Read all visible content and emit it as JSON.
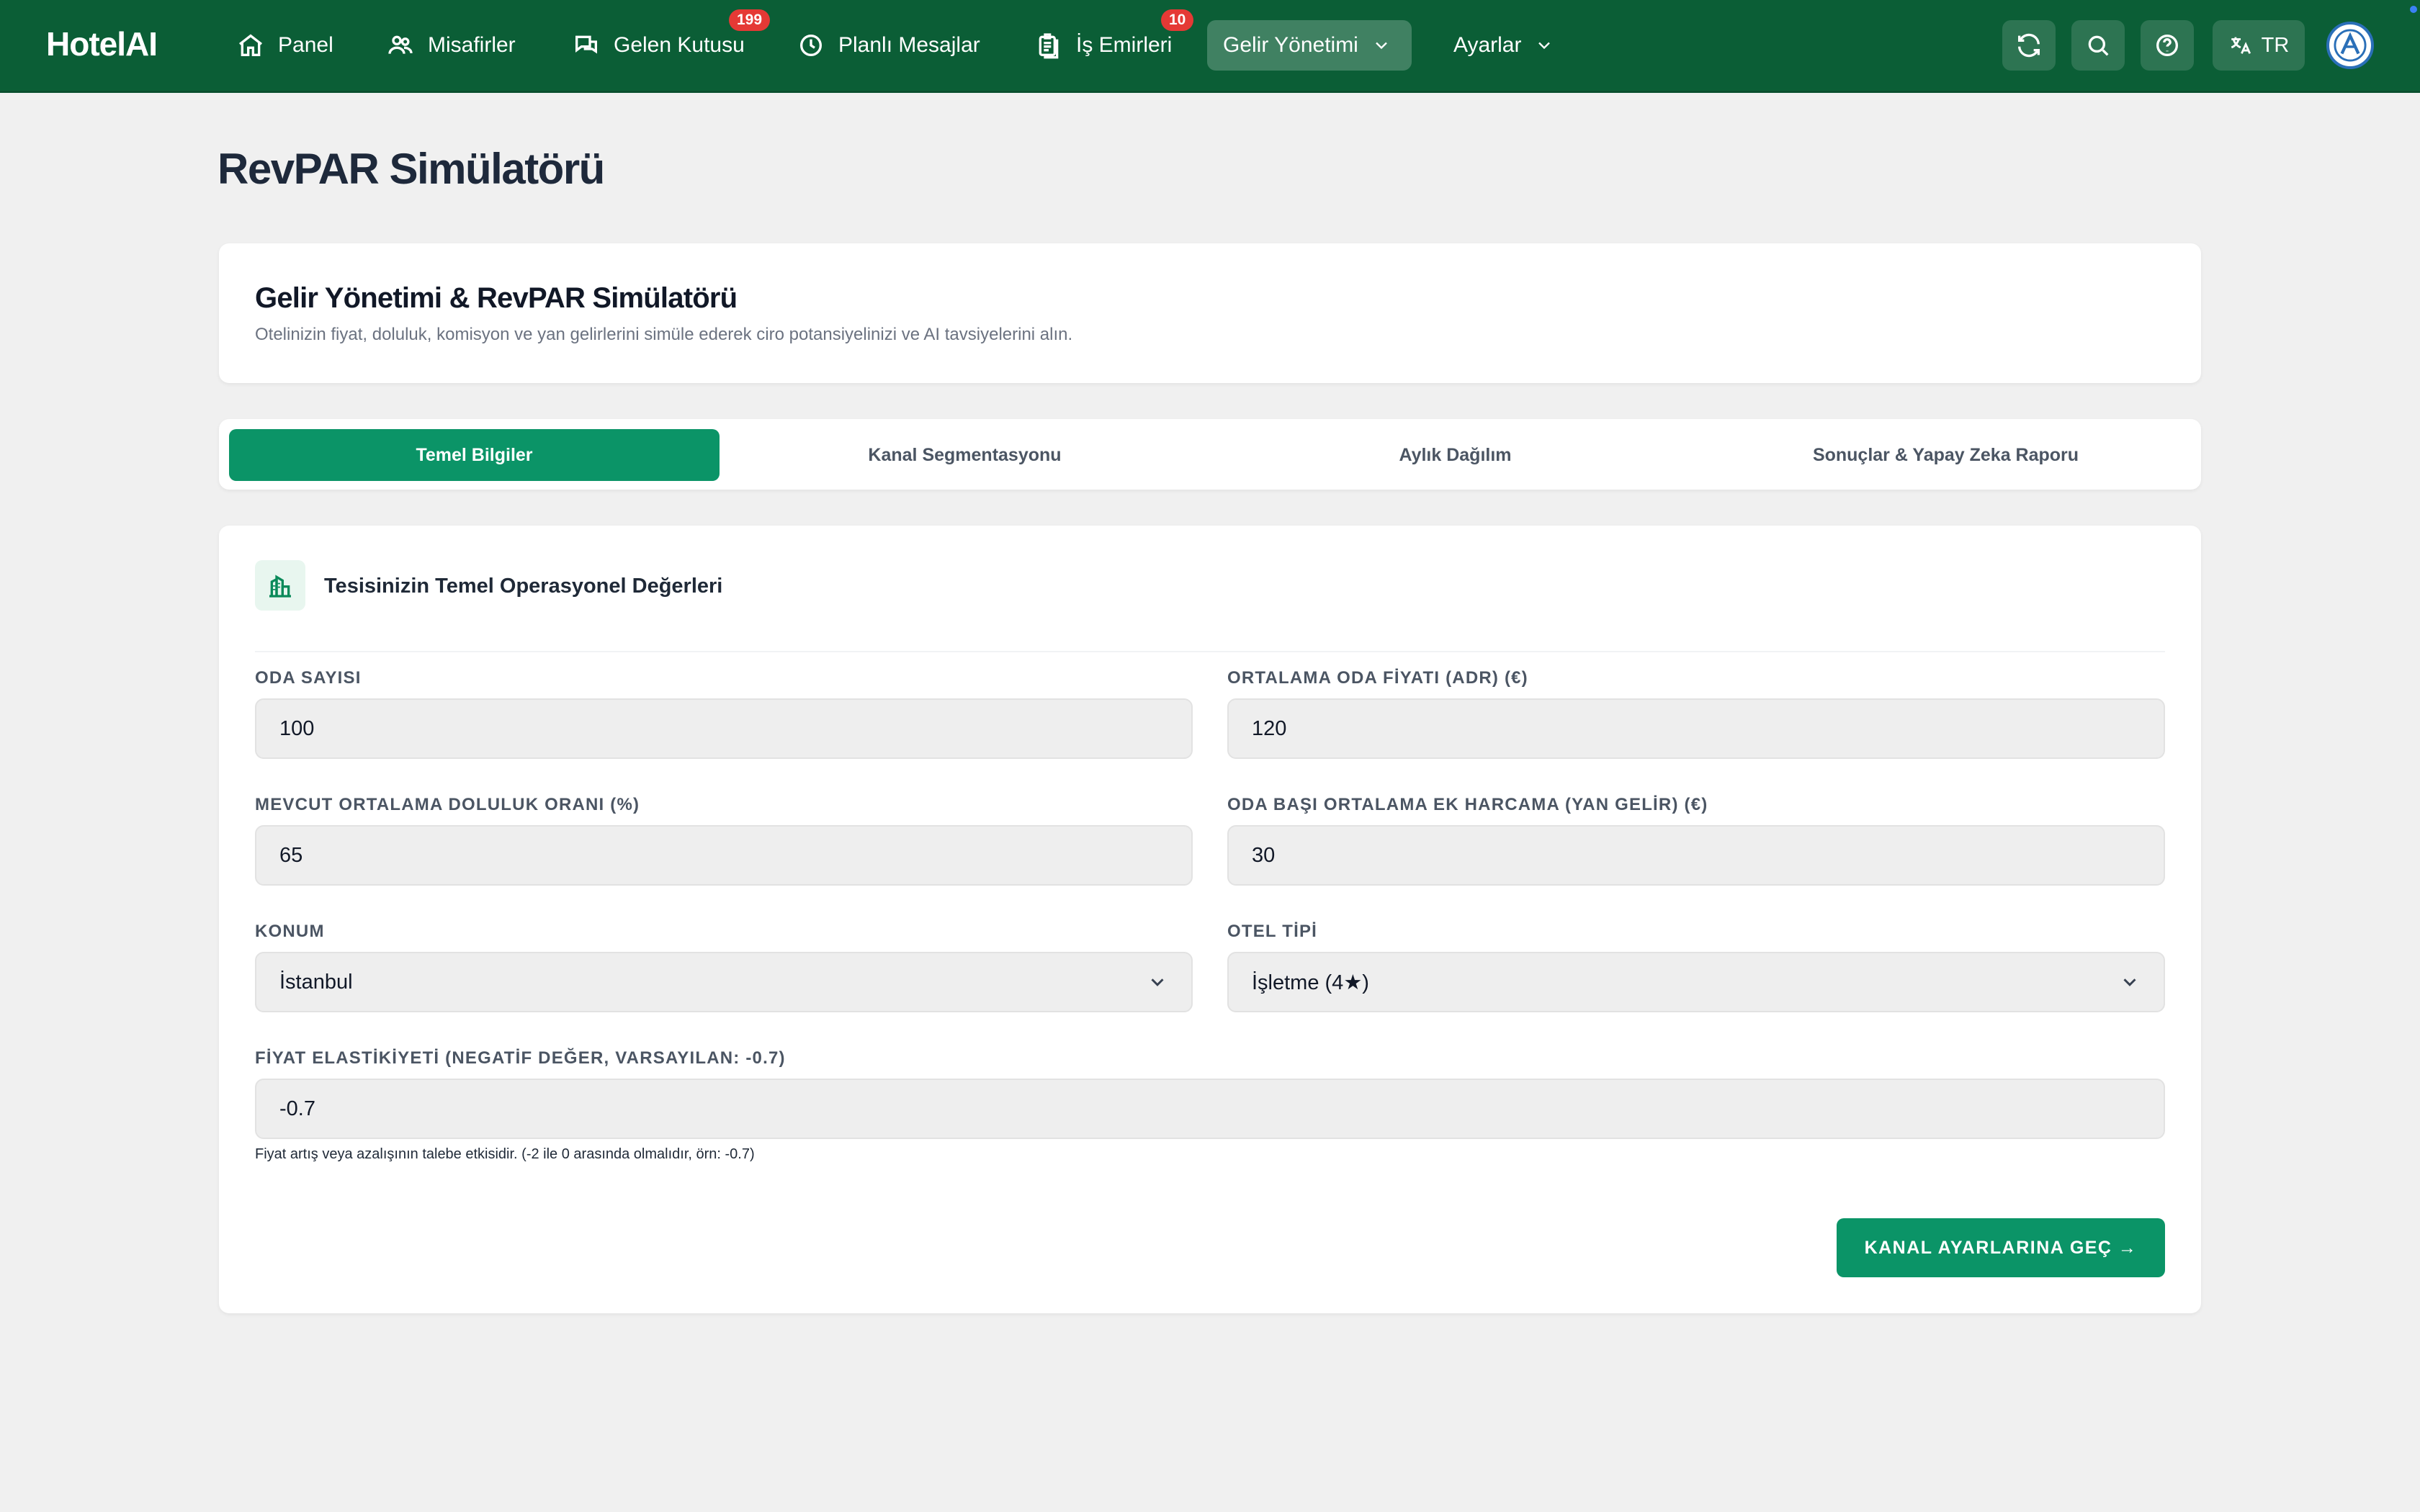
{
  "brand": "HotelAI",
  "nav": {
    "panel": "Panel",
    "guests": "Misafirler",
    "inbox": "Gelen Kutusu",
    "inbox_badge": "199",
    "scheduled": "Planlı Mesajlar",
    "work_orders": "İş Emirleri",
    "work_orders_badge": "10",
    "revenue": "Gelir Yönetimi",
    "settings": "Ayarlar",
    "lang": "TR"
  },
  "page_title": "RevPAR Simülatörü",
  "intro": {
    "title": "Gelir Yönetimi & RevPAR Simülatörü",
    "subtitle": "Otelinizin fiyat, doluluk, komisyon ve yan gelirlerini simüle ederek ciro potansiyelinizi ve AI tavsiyelerini alın."
  },
  "tabs": [
    "Temel Bilgiler",
    "Kanal Segmentasyonu",
    "Aylık Dağılım",
    "Sonuçlar & Yapay Zeka Raporu"
  ],
  "section_title": "Tesisinizin Temel Operasyonel Değerleri",
  "fields": {
    "rooms": {
      "label": "ODA SAYISI",
      "value": "100"
    },
    "adr": {
      "label": "ORTALAMA ODA FİYATI (ADR) (€)",
      "value": "120"
    },
    "occupancy": {
      "label": "MEVCUT ORTALAMA DOLULUK ORANI (%)",
      "value": "65"
    },
    "ancillary": {
      "label": "ODA BAŞI ORTALAMA EK HARCAMA (YAN GELİR) (€)",
      "value": "30"
    },
    "location": {
      "label": "KONUM",
      "value": "İstanbul"
    },
    "hotel_type": {
      "label": "OTEL TİPİ",
      "value": "İşletme (4★)"
    },
    "elasticity": {
      "label": "FİYAT ELASTİKİYETİ (NEGATİF DEĞER, VARSAYILAN: -0.7)",
      "value": "-0.7"
    }
  },
  "help_text": "Fiyat artış veya azalışının talebe etkisidir. (-2 ile 0 arasında olmalıdır, örn: -0.7)",
  "cta": "KANAL AYARLARINA GEÇ →",
  "colors": {
    "nav_bg": "#0b5e36",
    "accent": "#0b9467",
    "badge": "#e53935"
  }
}
